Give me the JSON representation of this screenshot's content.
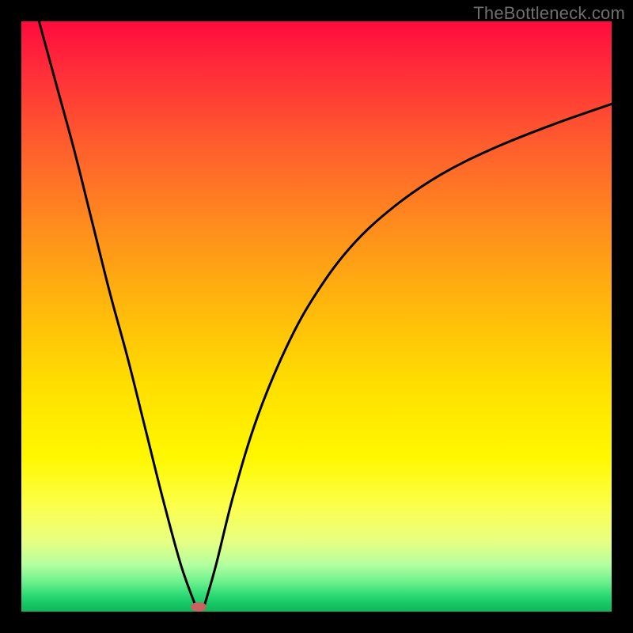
{
  "watermark": "TheBottleneck.com",
  "chart_data": {
    "type": "line",
    "title": "",
    "xlabel": "",
    "ylabel": "",
    "xlim": [
      0,
      100
    ],
    "ylim": [
      0,
      100
    ],
    "grid": false,
    "legend": false,
    "series": [
      {
        "name": "left-branch",
        "x": [
          3,
          6,
          9,
          12,
          15,
          18,
          21,
          24,
          27,
          29.5
        ],
        "y": [
          100,
          89,
          78,
          66,
          54,
          43,
          31,
          19,
          8,
          1
        ]
      },
      {
        "name": "right-branch",
        "x": [
          31,
          33,
          36,
          40,
          45,
          50,
          56,
          63,
          71,
          80,
          90,
          100
        ],
        "y": [
          1,
          8,
          20,
          33,
          45,
          54,
          62,
          68.5,
          74,
          78.5,
          82.5,
          86
        ]
      }
    ],
    "marker": {
      "x": 30,
      "y": 0.8,
      "color": "#c96361"
    },
    "background_gradient": {
      "top": "#ff0b3d",
      "mid": "#ffe000",
      "bottom": "#0eb85a"
    }
  }
}
